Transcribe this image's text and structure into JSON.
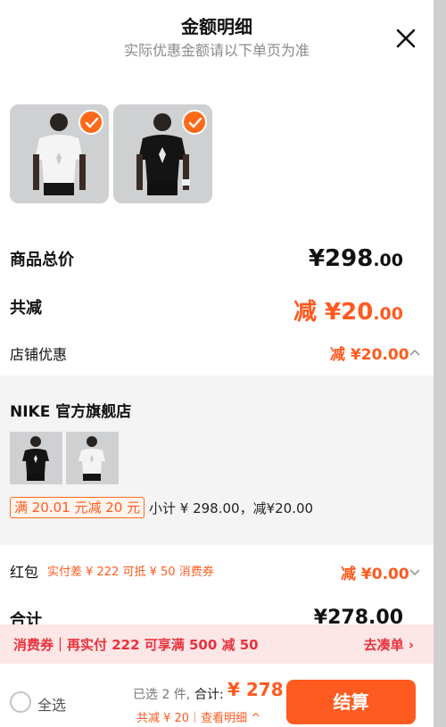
{
  "header": {
    "title": "金额明细",
    "subtitle": "实际优惠金额请以下单页为准"
  },
  "summary": {
    "total_label": "商品总价",
    "total_value_main": "¥298",
    "total_value_dec": ".00",
    "reduce_label": "共减",
    "reduce_value_main": "减 ¥20",
    "reduce_value_dec": ".00",
    "store_discount_label": "店铺优惠",
    "store_discount_value": "减 ¥20.00",
    "hongbao_label": "红包",
    "hongbao_note": "实付差 ¥ 222 可抵 ¥ 50 消费券",
    "hongbao_value": "减 ¥0.00",
    "sum_label": "合计",
    "sum_value": "¥278.00"
  },
  "store": {
    "name": "NIKE 官方旗舰店",
    "promo_tag": "满 20.01 元减 20 元",
    "subtotal": "小计 ¥ 298.00，减¥20.00"
  },
  "banner": {
    "left": "消费券｜再实付 222 可享满 500 减 50",
    "right": "去凑单 ›"
  },
  "footer": {
    "select_all": "全选",
    "selected_count": "已选 2 件,",
    "total_label": "合计:",
    "total_value": "¥ 278",
    "discount_line": "共减 ¥ 20｜查看明细 ^",
    "checkout": "结算"
  },
  "colors": {
    "accent": "#ff5a1f",
    "banner_bg": "#fde6e6",
    "banner_text": "#e8323c"
  }
}
